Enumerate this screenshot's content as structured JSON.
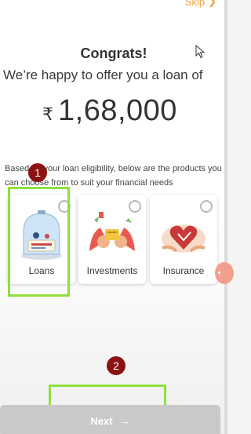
{
  "header": {
    "skip_label": "Skip"
  },
  "offer": {
    "title": "Congrats!",
    "subtitle": "We’re happy to offer you a loan of",
    "currency_symbol": "₹",
    "amount": "1,68,000"
  },
  "eligibility_text": "Based on your loan eligibility, below are the products you can choose from to suit your financial needs",
  "products": [
    {
      "label": "Loans",
      "selected": false
    },
    {
      "label": "Investments",
      "selected": false
    },
    {
      "label": "Insurance",
      "selected": false
    }
  ],
  "annotations": [
    {
      "label": "1"
    },
    {
      "label": "2"
    }
  ],
  "footer": {
    "next_label": "Next",
    "next_icon": "arrow-right-icon"
  },
  "colors": {
    "accent": "#f3a33a",
    "highlight": "#8ee13a",
    "marker": "#8b1212",
    "disabled_button": "#c9c9c9"
  }
}
